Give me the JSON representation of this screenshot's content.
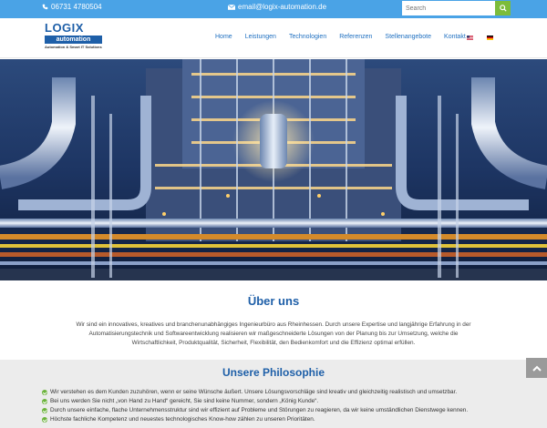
{
  "topbar": {
    "phone": "06731 4780504",
    "email": "email@logix-automation.de",
    "search_placeholder": "Search"
  },
  "logo": {
    "word": "LOGIX",
    "sub": "automation",
    "tagline": "Automation & Smart IT Solutions"
  },
  "nav": {
    "items": [
      "Home",
      "Leistungen",
      "Technologien",
      "Referenzen",
      "Stellenangebote",
      "Kontakt"
    ]
  },
  "about": {
    "title": "Über uns",
    "line1": "Wir sind ein innovatives, kreatives und branchenunabhängiges Ingenieurbüro aus Rheinhessen. Durch unsere Expertise und langjährige Erfahrung in der",
    "line2": "Automatisierungstechnik und Softwareentwicklung realisieren wir maßgeschneiderte Lösungen von der Planung bis zur Umsetzung, welche die",
    "line3": "Wirtschaftlichkeit, Produktqualität, Sicherheit, Flexibilität, den Bedienkomfort und die Effizienz optimal erfüllen."
  },
  "philosophy": {
    "title": "Unsere Philosophie",
    "items": [
      "Wir verstehen es dem Kunden zuzuhören, wenn er seine Wünsche äußert. Unsere Lösungsvorschläge sind kreativ und gleichzeitig realistisch und umsetzbar.",
      "Bei uns werden Sie nicht „von Hand zu Hand“ gereicht, Sie sind keine Nummer, sondern „König Kunde“.",
      "Durch unsere einfache, flache Unternehmensstruktur sind wir effizient auf Probleme und Störungen zu reagieren, da wir keine umständlichen Dienstwege kennen.",
      "Höchste fachliche Kompetenz und neuestes technologisches Know-how zählen zu unseren Prioritäten."
    ]
  },
  "colors": {
    "topbar": "#4aa3e6",
    "brand_blue": "#1e5fa8",
    "brand_green": "#7cbc3a"
  },
  "icons": {
    "phone": "phone-icon",
    "email": "envelope-icon",
    "search": "search-icon",
    "scroll_top": "chevron-up-icon",
    "list_check": "check-circle-icon"
  }
}
